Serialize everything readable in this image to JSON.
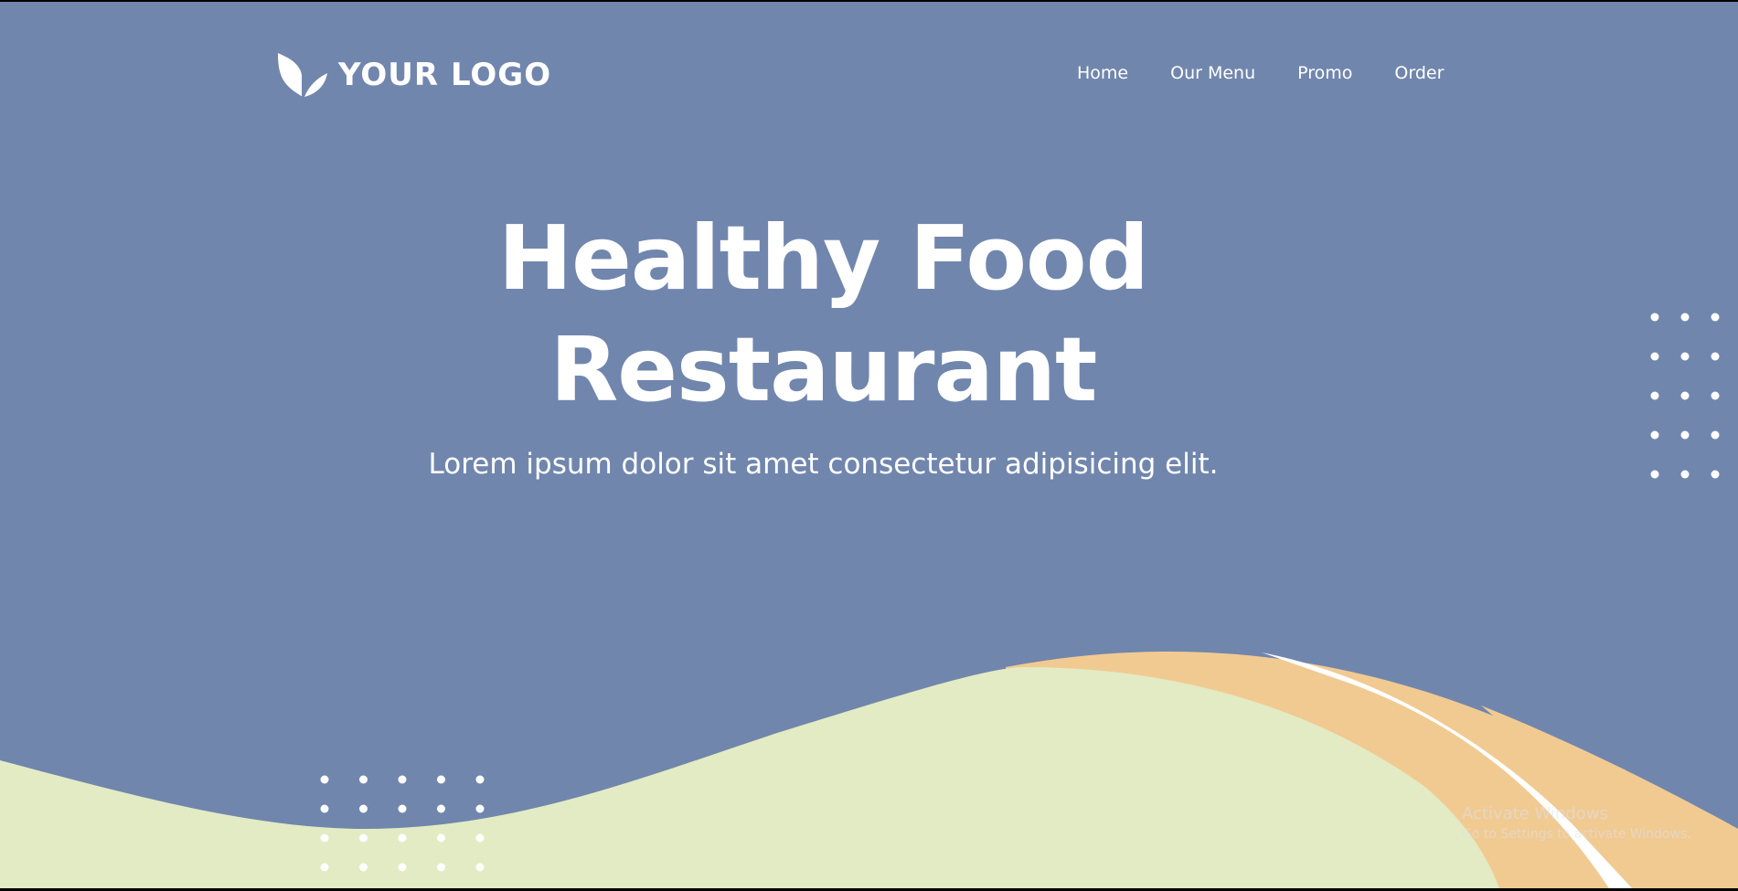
{
  "brand": {
    "logo_text": "YOUR LOGO",
    "logo_icon": "leaf-icon"
  },
  "nav": [
    {
      "label": "Home"
    },
    {
      "label": "Our Menu"
    },
    {
      "label": "Promo"
    },
    {
      "label": "Order"
    }
  ],
  "hero": {
    "title_line1": "Healthy Food",
    "title_line2": "Restaurant",
    "subtitle": "Lorem ipsum dolor sit amet consectetur adipisicing elit."
  },
  "watermark": {
    "line1": "Activate Windows",
    "line2": "Go to Settings to activate Windows."
  },
  "colors": {
    "background": "#7186ad",
    "wave_green": "#e2ebc3",
    "wave_orange": "#f1ca92",
    "text": "#ffffff"
  }
}
